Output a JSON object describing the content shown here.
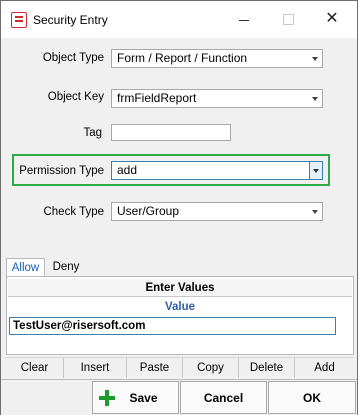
{
  "window": {
    "title": "Security Entry",
    "close_glyph": "✕"
  },
  "form": {
    "object_type": {
      "label": "Object Type",
      "value": "Form / Report / Function"
    },
    "object_key": {
      "label": "Object Key",
      "value": "frmFieldReport"
    },
    "tag": {
      "label": "Tag",
      "value": ""
    },
    "permission_type": {
      "label": "Permission Type",
      "value": "add",
      "highlight_color": "#2eab48"
    },
    "check_type": {
      "label": "Check Type",
      "value": "User/Group"
    }
  },
  "tabs": [
    {
      "label": "Allow",
      "selected": true
    },
    {
      "label": "Deny",
      "selected": false
    }
  ],
  "grid": {
    "title": "Enter Values",
    "column": "Value",
    "rows": [
      "TestUser@risersoft.com"
    ],
    "buttons": [
      "Clear",
      "Insert",
      "Paste",
      "Copy",
      "Delete",
      "Add"
    ]
  },
  "actions": {
    "save": "Save",
    "cancel": "Cancel",
    "ok": "OK"
  },
  "colors": {
    "accent": "#2b5fa5",
    "plus": "#1c9a2c"
  }
}
